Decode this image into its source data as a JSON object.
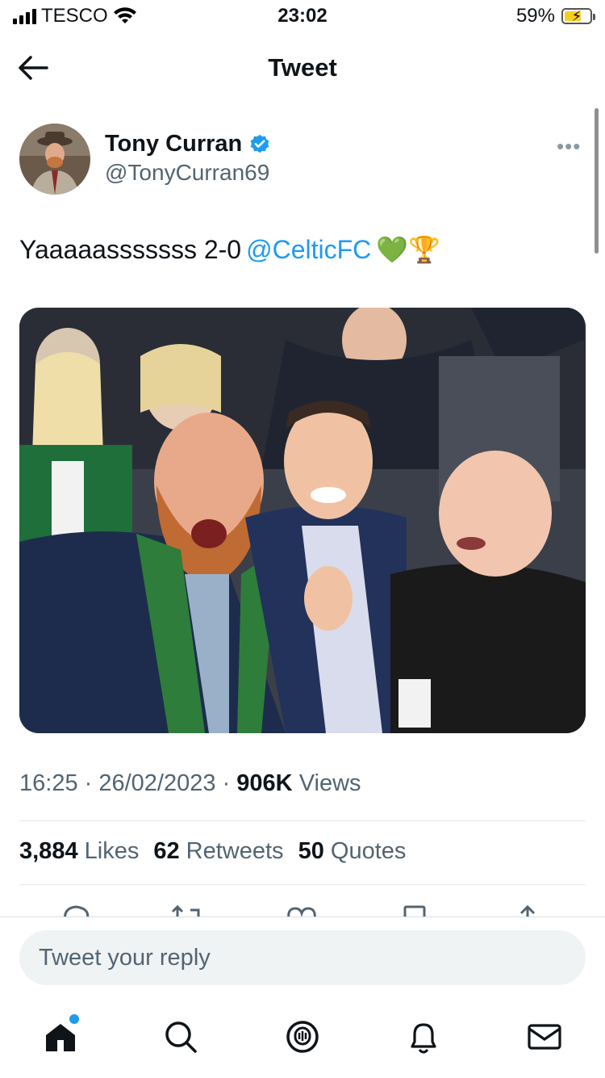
{
  "status_bar": {
    "carrier": "TESCO",
    "time": "23:02",
    "battery": "59%",
    "battery_level": 0.59,
    "icons": [
      "signal-icon",
      "wifi-icon",
      "battery-charging-icon"
    ]
  },
  "header": {
    "title": "Tweet",
    "back_icon": "back-arrow-icon"
  },
  "tweet": {
    "author_name": "Tony Curran",
    "handle": "@TonyCurran69",
    "verified": true,
    "more_icon": "more-dots-icon",
    "text_prefix": "Yaaaaasssssss 2-0 ",
    "mention": "@CelticFC",
    "emojis": "💚🏆",
    "photo_description_icon": "photo",
    "time": "16:25",
    "date": "26/02/2023",
    "views_count": "906K",
    "views_label": "Views",
    "likes_count": "3,884",
    "likes_label": "Likes",
    "retweets_count": "62",
    "retweets_label": "Retweets",
    "quotes_count": "50",
    "quotes_label": "Quotes",
    "actions": [
      "reply-icon",
      "retweet-icon",
      "like-icon",
      "bookmark-icon",
      "share-icon"
    ]
  },
  "reply": {
    "placeholder": "Tweet your reply"
  },
  "tabbar": {
    "items": [
      "home-icon",
      "search-icon",
      "spaces-icon",
      "notifications-icon",
      "messages-icon"
    ],
    "home_has_new": true
  },
  "colors": {
    "accent": "#1d9bf0",
    "text": "#0f1419",
    "secondary": "#536471",
    "reply_bg": "#eff3f4",
    "verified": "#1d9bf0"
  }
}
